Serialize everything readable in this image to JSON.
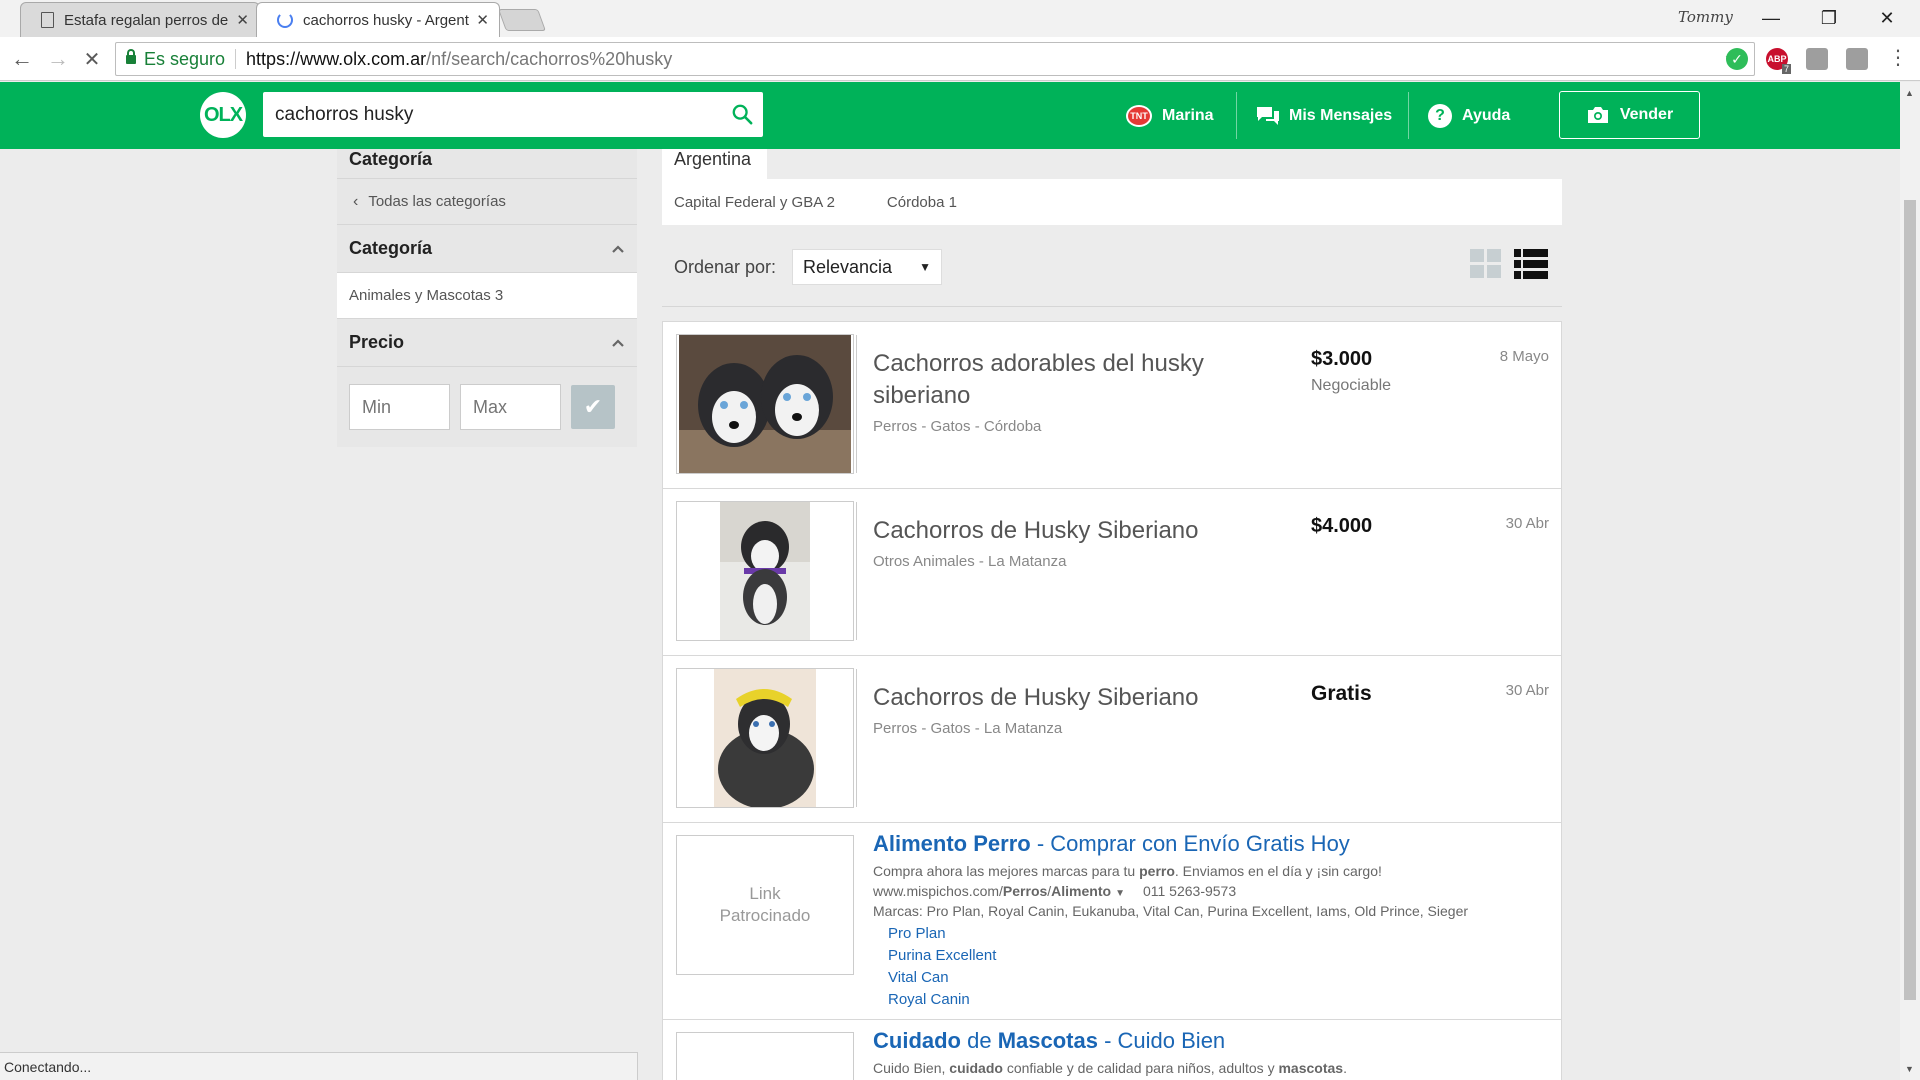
{
  "browser": {
    "tabs": [
      {
        "title": "Estafa regalan perros de"
      },
      {
        "title": "cachorros husky - Argent"
      }
    ],
    "profile": "Tommy",
    "secure_label": "Es seguro",
    "url_host": "https://www.olx.com.ar",
    "url_path": "/nf/search/cachorros%20husky",
    "status": "Conectando...",
    "ext_badge": "7"
  },
  "header": {
    "logo": "OLX",
    "search_value": "cachorros husky",
    "user": "Marina",
    "messages": "Mis Mensajes",
    "help": "Ayuda",
    "sell": "Vender"
  },
  "sidebar": {
    "top_title": "Categoría",
    "all_categories": "Todas las categorías",
    "category_title": "Categoría",
    "category_item": "Animales y Mascotas 3",
    "price_title": "Precio",
    "min_placeholder": "Min",
    "max_placeholder": "Max"
  },
  "main": {
    "location_tab": "Argentina",
    "locations": [
      "Capital Federal y GBA 2",
      "Córdoba 1"
    ],
    "sort_label": "Ordenar por:",
    "sort_value": "Relevancia"
  },
  "listings": [
    {
      "title": "Cachorros adorables del husky siberiano",
      "subtitle": "Perros - Gatos - Córdoba",
      "price": "$3.000",
      "negotiable": "Negociable",
      "date": "8 Mayo"
    },
    {
      "title": "Cachorros de Husky Siberiano",
      "subtitle": "Otros Animales - La Matanza",
      "price": "$4.000",
      "negotiable": "",
      "date": "30 Abr"
    },
    {
      "title": "Cachorros de Husky Siberiano",
      "subtitle": "Perros - Gatos - La Matanza",
      "price": "Gratis",
      "negotiable": "",
      "date": "30 Abr"
    }
  ],
  "ads": [
    {
      "placeholder_line1": "Link",
      "placeholder_line2": "Patrocinado",
      "title_bold": "Alimento Perro",
      "title_rest": " - Comprar con Envío Gratis Hoy",
      "desc_a": "Compra ahora las mejores marcas para tu ",
      "desc_b": "perro",
      "desc_c": ". Enviamos en el día y ¡sin cargo!",
      "url_a": "www.mispichos.com/",
      "url_b": "Perros",
      "url_c": "/",
      "url_d": "Alimento",
      "phone": "011 5263-9573",
      "brands": "Marcas: Pro Plan, Royal Canin, Eukanuba, Vital Can, Purina Excellent, Iams, Old Prince, Sieger",
      "links": [
        "Pro Plan",
        "Purina Excellent",
        "Vital Can",
        "Royal Canin"
      ]
    },
    {
      "title_bold": "Cuidado",
      "title_mid": " de ",
      "title_bold2": "Mascotas",
      "title_rest": " - Cuido Bien",
      "desc_a": "Cuido Bien, ",
      "desc_b": "cuidado",
      "desc_c": " confiable y de calidad para niños, adultos y ",
      "desc_d": "mascotas",
      "desc_e": "."
    }
  ],
  "colors": {
    "brand_green": "#00b259",
    "link_blue": "#1a66b5"
  }
}
